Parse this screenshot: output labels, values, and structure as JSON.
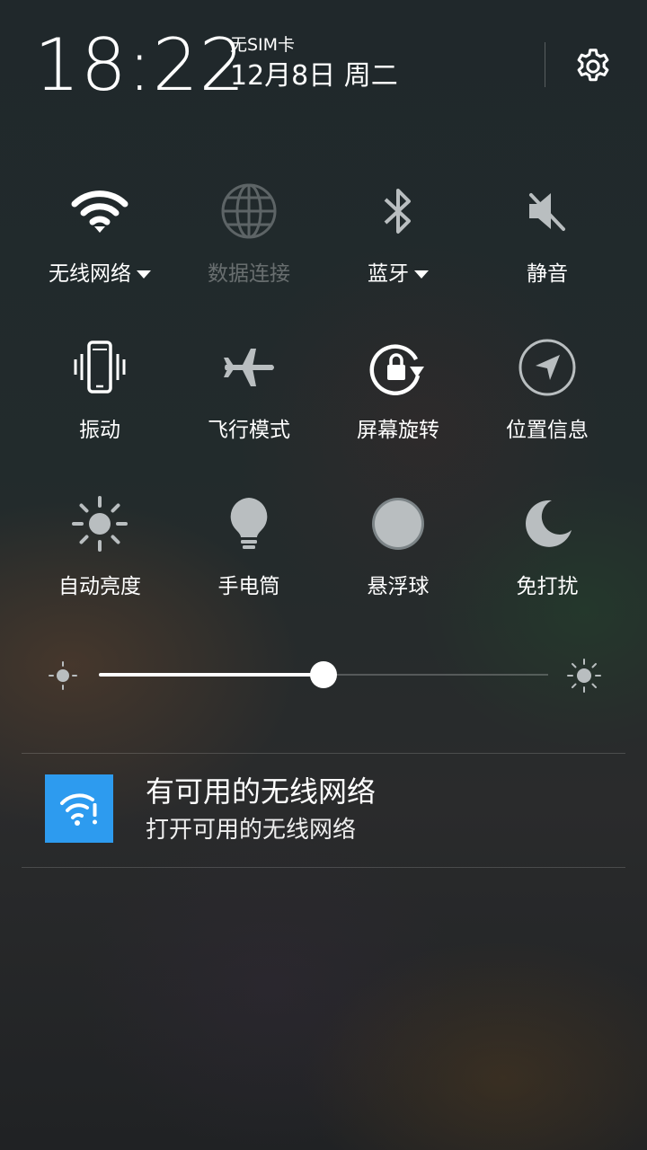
{
  "header": {
    "time": "18:22",
    "sim_status": "无SIM卡",
    "date": "12月8日 周二"
  },
  "toggles": [
    {
      "label": "无线网络",
      "icon": "wifi-icon",
      "state": "on",
      "has_dropdown": true
    },
    {
      "label": "数据连接",
      "icon": "globe-icon",
      "state": "disabled",
      "has_dropdown": false
    },
    {
      "label": "蓝牙",
      "icon": "bluetooth-icon",
      "state": "off",
      "has_dropdown": true
    },
    {
      "label": "静音",
      "icon": "mute-icon",
      "state": "off",
      "has_dropdown": false
    },
    {
      "label": "振动",
      "icon": "vibrate-phone-icon",
      "state": "on",
      "has_dropdown": false
    },
    {
      "label": "飞行模式",
      "icon": "airplane-icon",
      "state": "off",
      "has_dropdown": false
    },
    {
      "label": "屏幕旋转",
      "icon": "rotation-lock-icon",
      "state": "on",
      "has_dropdown": false
    },
    {
      "label": "位置信息",
      "icon": "location-arrow-icon",
      "state": "off",
      "has_dropdown": false
    },
    {
      "label": "自动亮度",
      "icon": "sun-icon",
      "state": "off",
      "has_dropdown": false
    },
    {
      "label": "手电筒",
      "icon": "lightbulb-icon",
      "state": "off",
      "has_dropdown": false
    },
    {
      "label": "悬浮球",
      "icon": "floating-ball-icon",
      "state": "off",
      "has_dropdown": false
    },
    {
      "label": "免打扰",
      "icon": "moon-icon",
      "state": "off",
      "has_dropdown": false
    }
  ],
  "brightness": {
    "level": 0.5
  },
  "notification": {
    "icon": "wifi-alert-icon",
    "title": "有可用的无线网络",
    "subtitle": "打开可用的无线网络",
    "icon_color": "#2d9bef"
  },
  "colors": {
    "active_icon": "#ffffff",
    "inactive_icon": "#b9bec0",
    "disabled_icon": "#5d6466",
    "accent": "#2d9bef"
  }
}
